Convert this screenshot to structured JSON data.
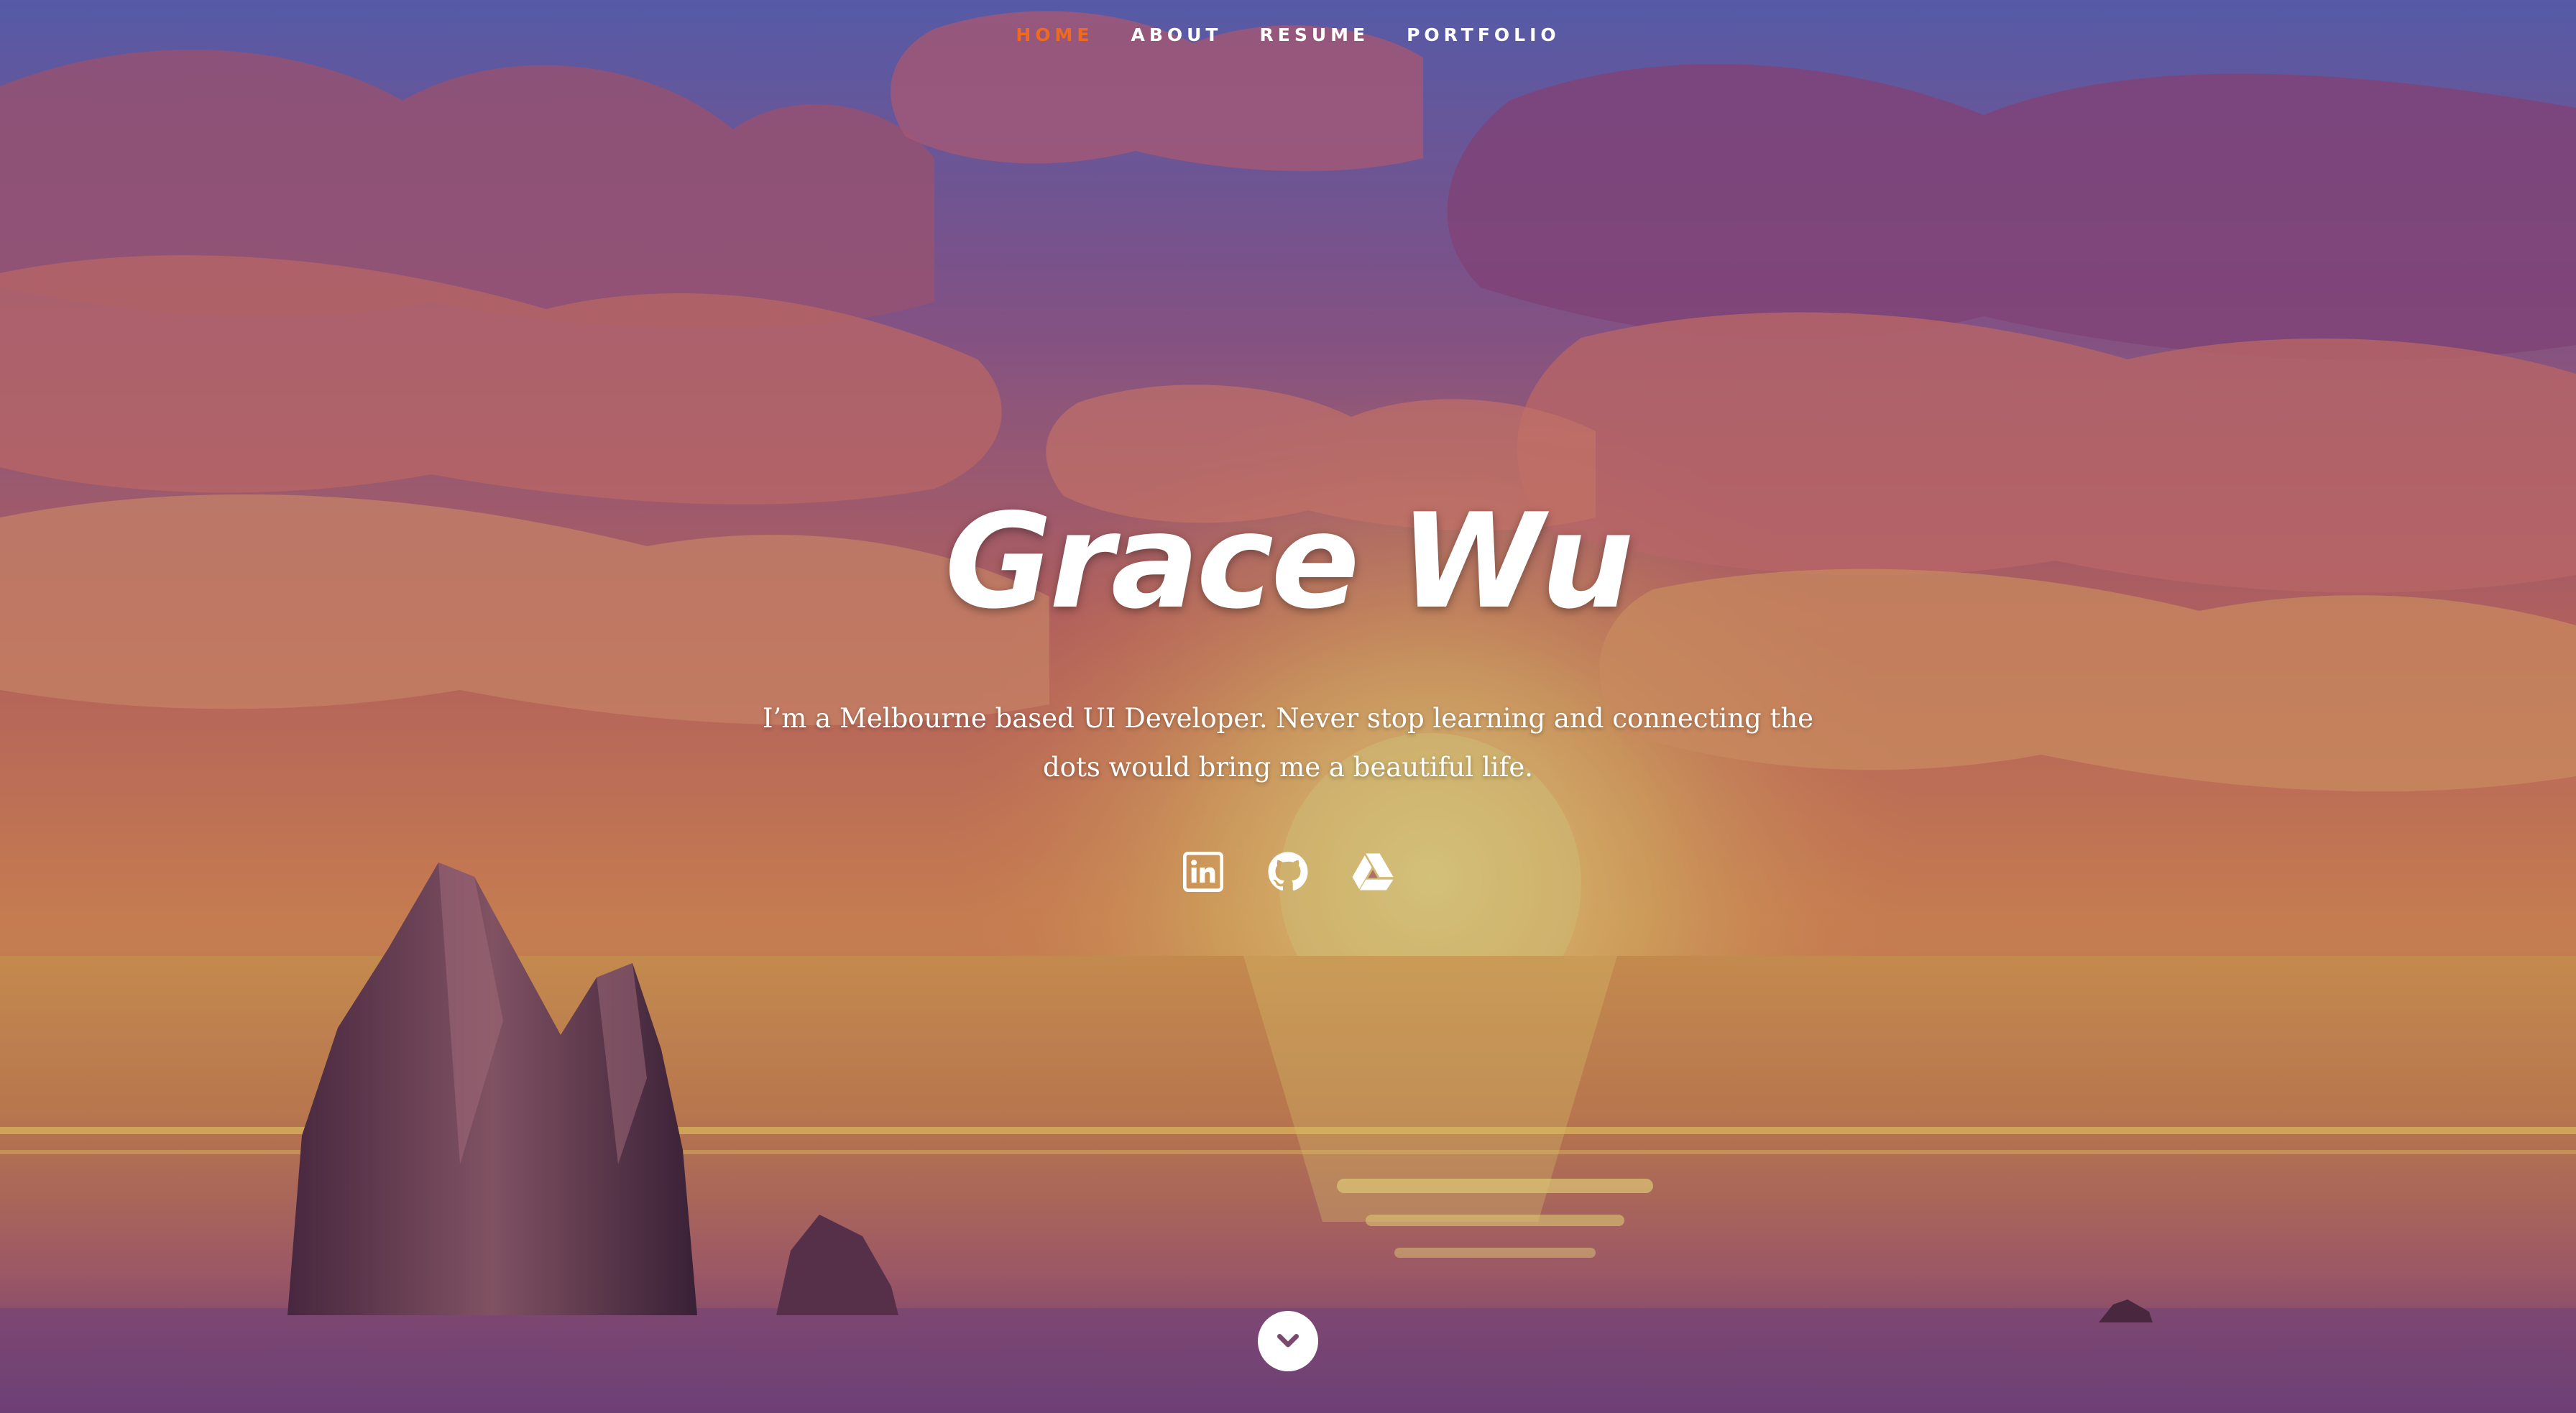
{
  "nav": {
    "items": [
      {
        "label": "Home",
        "active": true
      },
      {
        "label": "About",
        "active": false
      },
      {
        "label": "Resume",
        "active": false
      },
      {
        "label": "Portfolio",
        "active": false
      }
    ]
  },
  "hero": {
    "name": "Grace Wu",
    "tagline": "I’m a Melbourne based UI Developer. Never stop learning and connecting the dots would bring me a beautiful life."
  },
  "social": [
    {
      "icon": "linkedin-icon"
    },
    {
      "icon": "github-icon"
    },
    {
      "icon": "google-drive-icon"
    }
  ],
  "scroll_down": {
    "icon": "chevron-down-icon"
  },
  "colors": {
    "nav_active": "#f06a1d",
    "nav_text": "#ffffff",
    "sky_top": "#5d5fb0",
    "sun_glow": "#e8d36a"
  }
}
